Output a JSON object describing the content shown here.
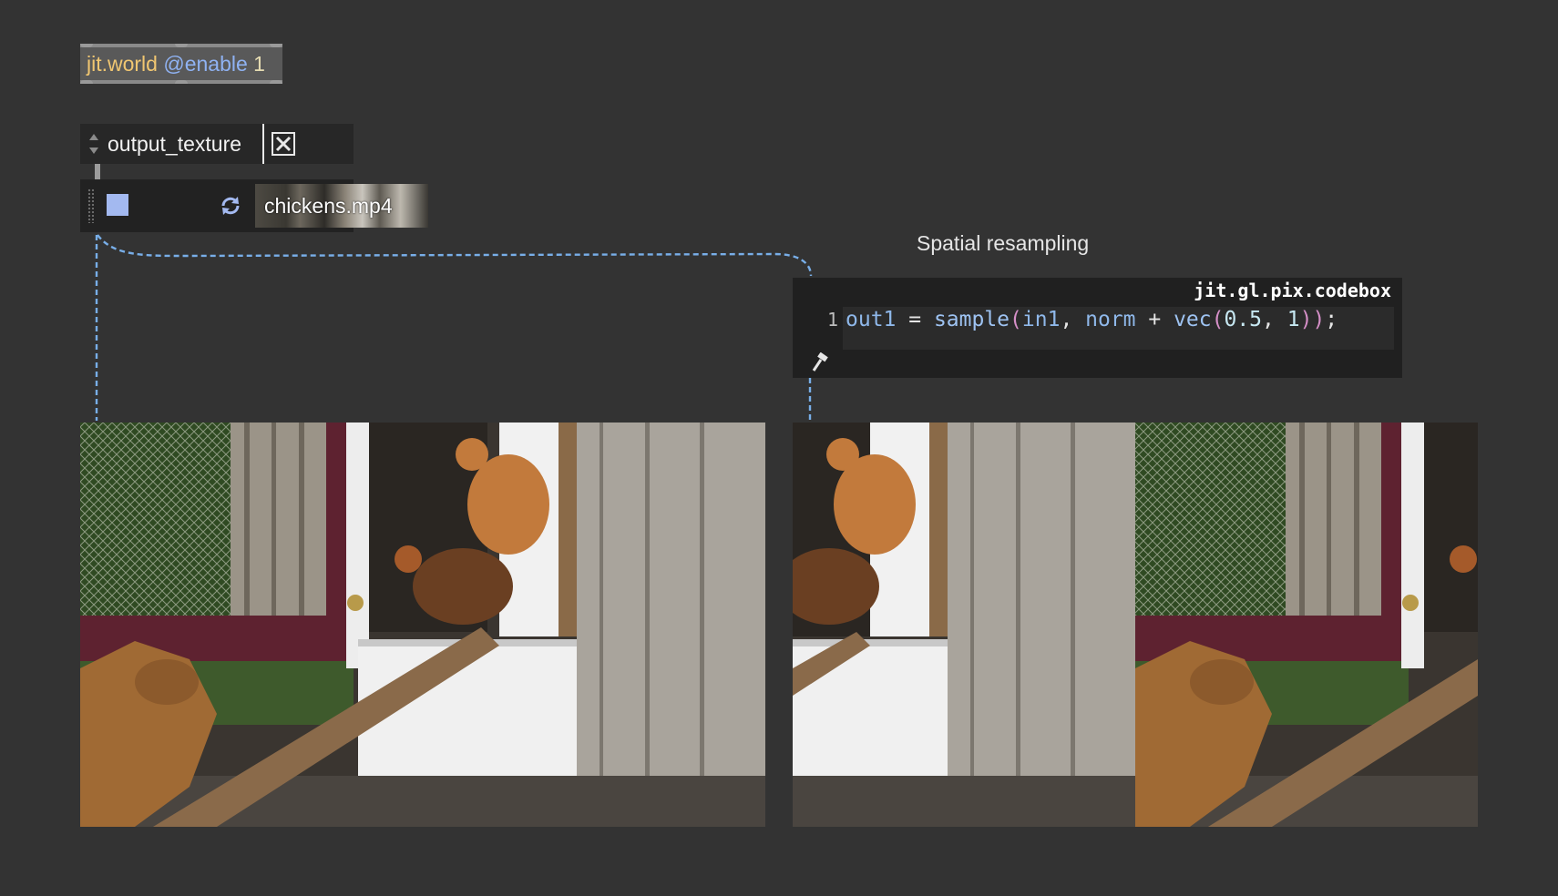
{
  "jit_world": {
    "class_name": "jit.world",
    "attribute": "@enable",
    "value": "1"
  },
  "umenu": {
    "selected": "output_texture"
  },
  "toggle": {
    "state": "on"
  },
  "player": {
    "filename": "chickens.mp4"
  },
  "caption": "Spatial resampling",
  "codebox": {
    "title": "jit.gl.pix.codebox",
    "line_number": "1",
    "code_tokens": {
      "out": "out1",
      "eq": " = ",
      "fn": "sample",
      "lp": "(",
      "in": "in1",
      "comma1": ", ",
      "norm": "norm",
      "plus": " + ",
      "vec": "vec",
      "lp2": "(",
      "n1": "0.5",
      "comma2": ", ",
      "n2": "1",
      "rp": "))",
      "semi": ";"
    }
  },
  "colors": {
    "background": "#333333",
    "patch_cord": "#78aee8",
    "object_class": "#f0c671",
    "attribute": "#8fb2f2"
  },
  "icons": {
    "stop": "stop-icon",
    "loop": "loop-icon",
    "close": "x-toggle-icon",
    "edit": "hammer-icon"
  }
}
